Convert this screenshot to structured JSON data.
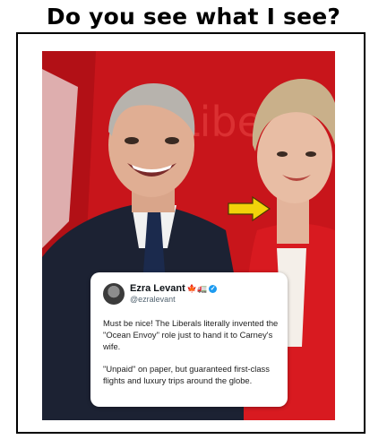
{
  "headline": "Do you see what I see?",
  "photo": {
    "background_sign_text": "Libe",
    "colors": {
      "backdrop_red": "#c8151b",
      "jacket_red": "#d81a20",
      "suit_navy": "#1c2233",
      "arrow_yellow": "#f2d20a"
    }
  },
  "tweet": {
    "name": "Ezra Levant",
    "emoji": "🍁🚛",
    "verified_icon": "verified-badge-icon",
    "handle": "@ezralevant",
    "paragraph1": "Must be nice! The Liberals literally invented the \"Ocean Envoy\" role just to hand it to Carney's wife.",
    "paragraph2": "\"Unpaid\" on paper, but guaranteed first-class flights and luxury trips around the globe."
  }
}
